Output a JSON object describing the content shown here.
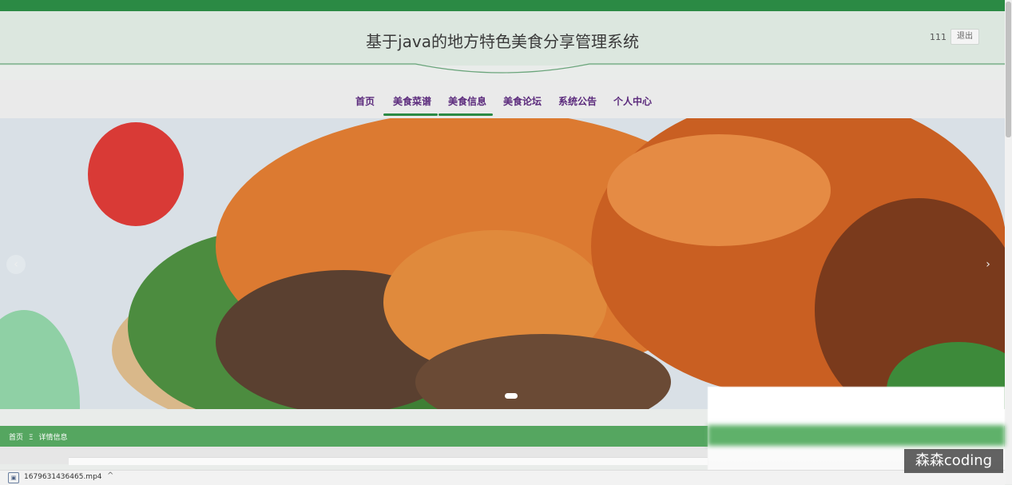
{
  "header": {
    "title": "基于java的地方特色美食分享管理系统",
    "username": "111",
    "logout_label": "退出"
  },
  "nav": {
    "items": [
      {
        "label": "首页"
      },
      {
        "label": "美食菜谱"
      },
      {
        "label": "美食信息"
      },
      {
        "label": "美食论坛"
      },
      {
        "label": "系统公告"
      },
      {
        "label": "个人中心"
      }
    ],
    "active_underlines": [
      "美食菜谱",
      "美食信息"
    ]
  },
  "banner": {
    "prev_glyph": "‹",
    "next_glyph": "›",
    "slides_indicator": 1
  },
  "breadcrumb": {
    "home": "首页",
    "separator": "Ξ",
    "current": "详情信息"
  },
  "download": {
    "filename": "1679631436465.mp4",
    "chevron": "^"
  },
  "watermark": "森森coding",
  "colors": {
    "brand_green": "#2b8a44",
    "nav_text": "#5b2a7c"
  }
}
